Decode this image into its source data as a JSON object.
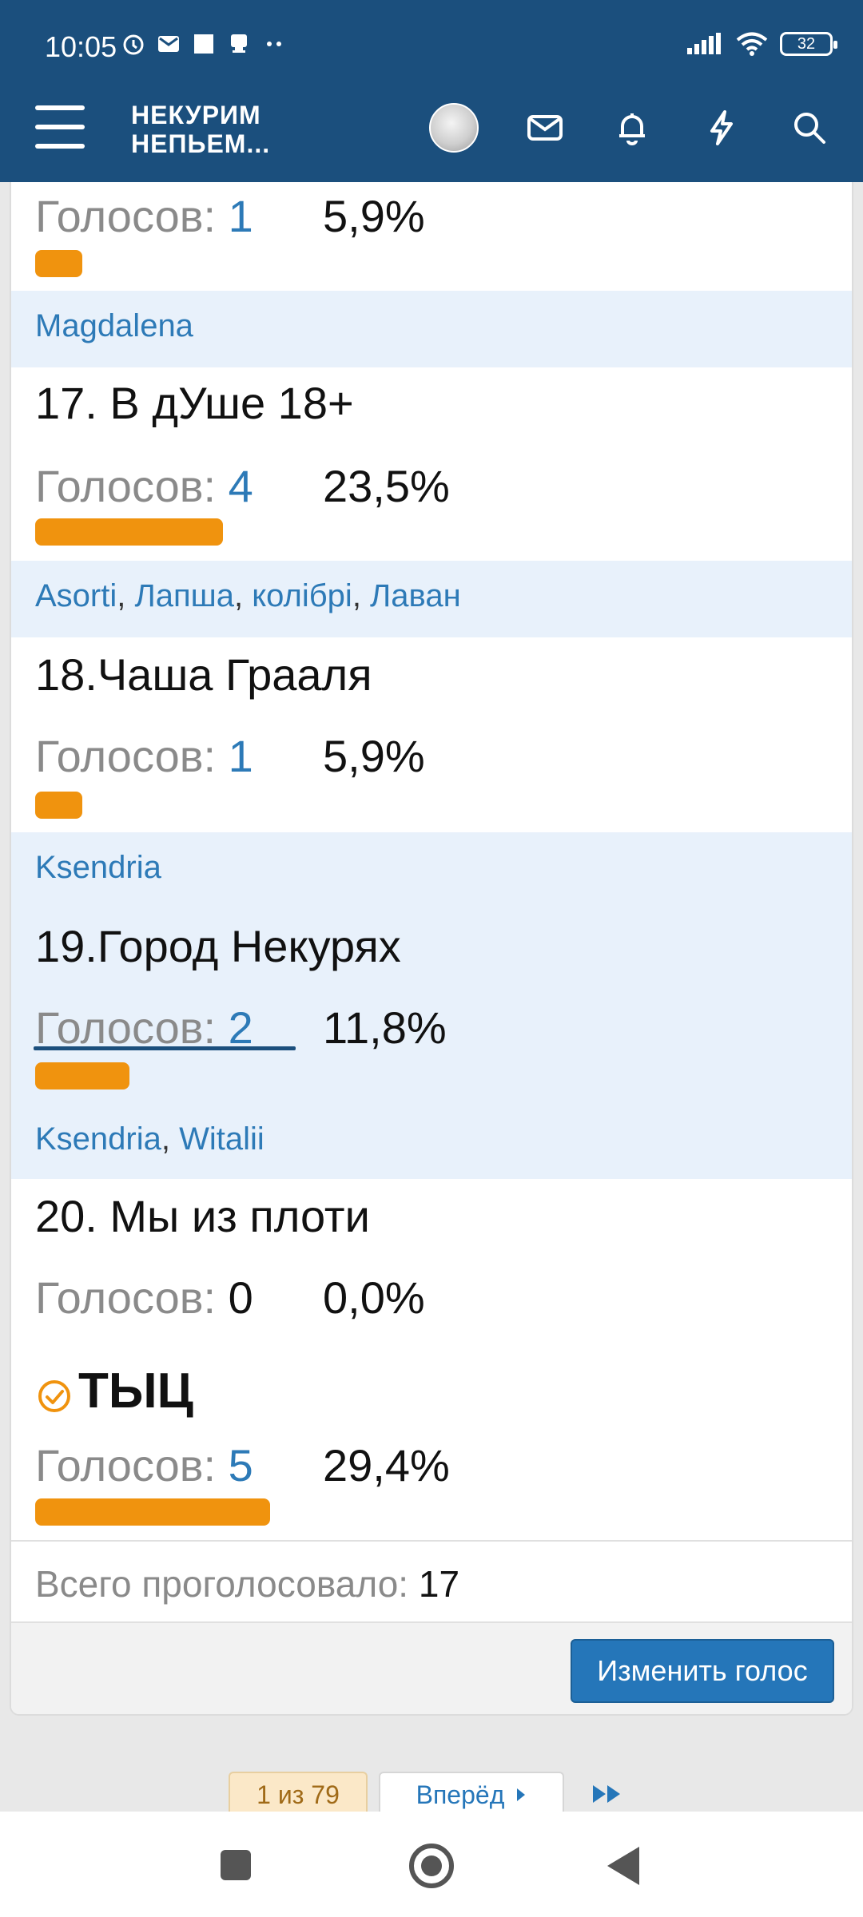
{
  "status_bar": {
    "time": "10:05",
    "battery": "32"
  },
  "header": {
    "logo_line1": "НЕКУРИМ",
    "logo_line2": "НЕПЬЕМ..."
  },
  "poll": {
    "votes_label": "Голосов:",
    "top_row": {
      "count": "1",
      "percent": "5,9%",
      "share": 0.059
    },
    "voters_16": [
      "Magdalena"
    ],
    "option_17": {
      "title": "17. В дУше 18+",
      "count": "4",
      "percent": "23,5%",
      "share": 0.235
    },
    "voters_17": [
      "Asorti",
      "Лапша",
      "колібрі",
      "Лаван"
    ],
    "option_18": {
      "title": "18.Чаша Грааля",
      "count": "1",
      "percent": "5,9%",
      "share": 0.059
    },
    "voters_18": [
      "Ksendria"
    ],
    "option_19": {
      "title": "19.Город Некурях",
      "count": "2",
      "percent": "11,8%",
      "share": 0.118
    },
    "voters_19": [
      "Ksendria",
      "Witalii"
    ],
    "option_20": {
      "title": "20. Мы из плоти",
      "count": "0",
      "percent": "0,0%",
      "share": 0.0
    },
    "option_tyc": {
      "title": "ТЫЦ",
      "count": "5",
      "percent": "29,4%",
      "share": 0.294
    },
    "total_label": "Всего проголосовало:",
    "total_value": "17",
    "change_vote_label": "Изменить голос"
  },
  "pagination": {
    "current": "1 из 79",
    "next_label": "Вперёд"
  },
  "colors": {
    "header_bg": "#1b4f7d",
    "bar": "#f0930e",
    "link": "#2d7ab7",
    "voters_bg": "#e8f1fb",
    "button": "#2576b9"
  }
}
